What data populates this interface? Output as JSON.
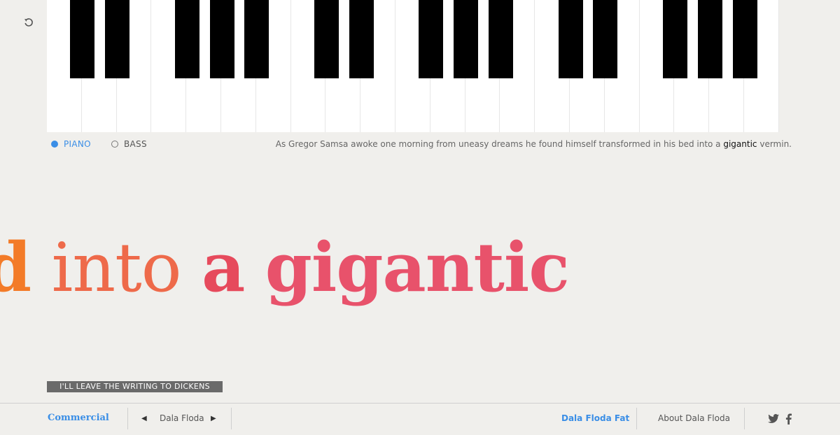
{
  "toolbar": {
    "reset_icon": "undo-icon"
  },
  "keyboard": {
    "white_key_count": 21,
    "black_keys": [
      {
        "after_white": 1
      },
      {
        "after_white": 2
      },
      {
        "after_white": 4
      },
      {
        "after_white": 5
      },
      {
        "after_white": 6
      },
      {
        "after_white": 8
      },
      {
        "after_white": 9
      },
      {
        "after_white": 11
      },
      {
        "after_white": 12
      },
      {
        "after_white": 13
      },
      {
        "after_white": 15
      },
      {
        "after_white": 16
      },
      {
        "after_white": 18
      },
      {
        "after_white": 19
      },
      {
        "after_white": 20
      }
    ]
  },
  "instruments": {
    "piano": {
      "label": "PIANO",
      "selected": true
    },
    "bass": {
      "label": "BASS",
      "selected": false
    }
  },
  "sample": {
    "before": "As Gregor Samsa awoke one morning from uneasy dreams he found himself transformed in his bed into a ",
    "highlight": "gigantic",
    "after": " vermin."
  },
  "display": {
    "word1": "d",
    "word2": "into",
    "word3": "a",
    "word4": "gigantic"
  },
  "leave_button": {
    "label": "I'LL LEAVE THE WRITING TO DICKENS"
  },
  "footer": {
    "commercial": "Commercial",
    "prev_icon": "triangle-left-icon",
    "font_name": "Dala Floda",
    "next_icon": "triangle-right-icon",
    "fat": "Dala Floda Fat",
    "about": "About Dala Floda",
    "twitter_icon": "twitter-icon",
    "facebook_icon": "facebook-icon"
  },
  "colors": {
    "accent": "#3a8ee6",
    "orange": "#f37b28",
    "coral": "#ee6a4a",
    "red": "#e64a5c",
    "pink": "#e8526b"
  }
}
